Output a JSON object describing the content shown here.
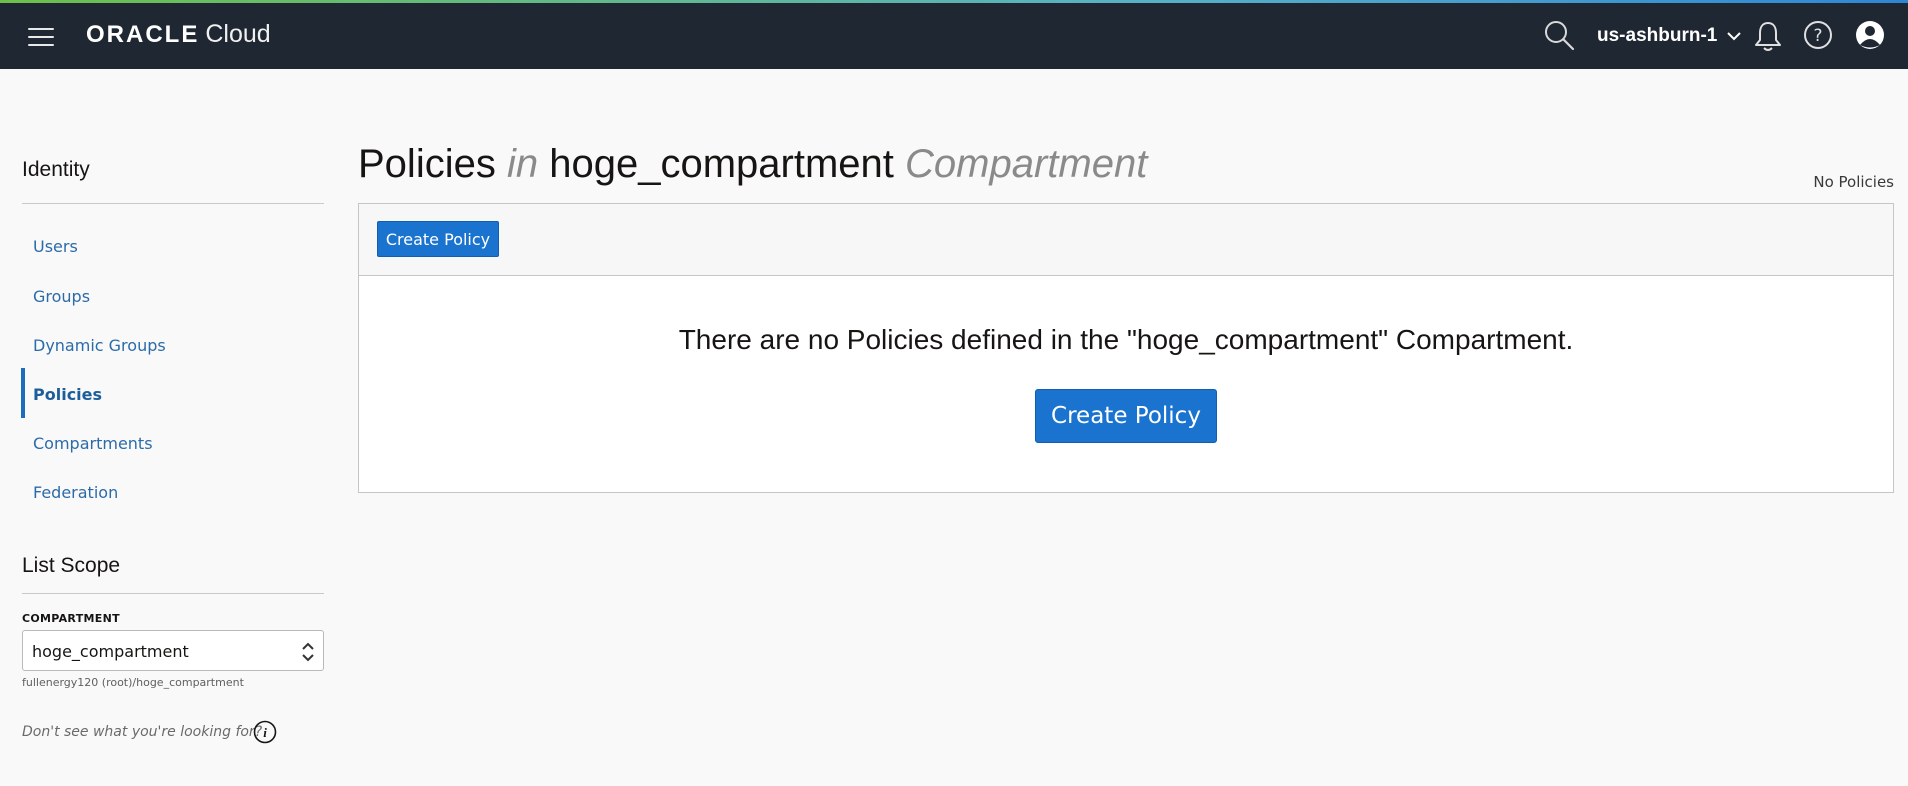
{
  "header": {
    "logo_brand": "ORACLE",
    "logo_product": "Cloud",
    "region": "us-ashburn-1",
    "icons": [
      "menu-icon",
      "search-icon",
      "chevron-down-icon",
      "bell-icon",
      "help-icon",
      "user-icon"
    ],
    "background_color": "#1f2733"
  },
  "sidebar": {
    "heading": "Identity",
    "items": [
      {
        "label": "Users",
        "active": false
      },
      {
        "label": "Groups",
        "active": false
      },
      {
        "label": "Dynamic Groups",
        "active": false
      },
      {
        "label": "Policies",
        "active": true
      },
      {
        "label": "Compartments",
        "active": false
      },
      {
        "label": "Federation",
        "active": false
      }
    ],
    "scope_heading": "List Scope",
    "compartment_label": "COMPARTMENT",
    "compartment_value": "hoge_compartment",
    "compartment_path": "fullenergy120 (root)/hoge_compartment",
    "help_text": "Don't see what you're looking for?"
  },
  "main": {
    "title_prefix": "Policies",
    "title_in": "in",
    "title_compartment": "hoge_compartment",
    "title_suffix": "Compartment",
    "count_text": "No Policies",
    "toolbar_button": "Create Policy",
    "empty_message": "There are no Policies defined in the \"hoge_compartment\" Compartment.",
    "empty_button": "Create Policy",
    "accent_color": "#1a73cf"
  }
}
